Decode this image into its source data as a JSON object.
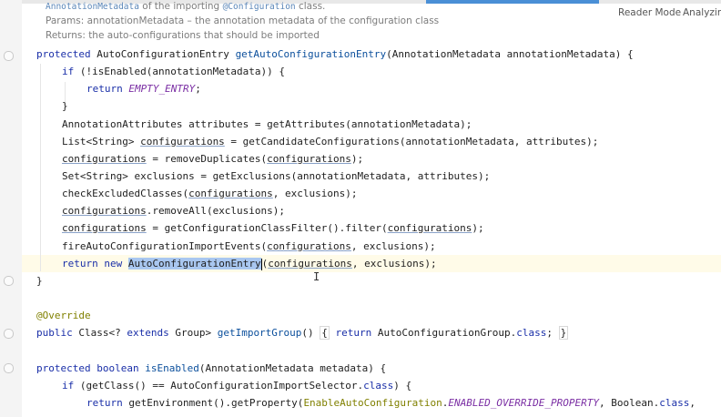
{
  "doc": {
    "line1_link": "AnnotationMetadata",
    "line1_mid": " of the importing ",
    "line1_link2": "@Configuration",
    "line1_end": " class.",
    "params": "Params: annotationMetadata – the annotation metadata of the configuration class",
    "returns": "Returns: the auto-configurations that should be imported"
  },
  "toolbar": {
    "reader_mode": "Reader Mode",
    "analyzing": "Analyzing..."
  },
  "code": {
    "l1": [
      "protected",
      " AutoConfigurationEntry ",
      "getAutoConfigurationEntry",
      "(AnnotationMetadata annotationMetadata) {"
    ],
    "l2": [
      "if",
      " (!isEnabled(annotationMetadata)) {"
    ],
    "l3": [
      "return",
      " ",
      "EMPTY_ENTRY",
      ";"
    ],
    "l4": "}",
    "l5": "AnnotationAttributes attributes = getAttributes(annotationMetadata);",
    "l6": [
      "List<String> ",
      "configurations",
      " = getCandidateConfigurations(annotationMetadata, attributes);"
    ],
    "l7": [
      "configurations",
      " = removeDuplicates(",
      "configurations",
      ");"
    ],
    "l8": "Set<String> exclusions = getExclusions(annotationMetadata, attributes);",
    "l9": [
      "checkExcludedClasses(",
      "configurations",
      ", exclusions);"
    ],
    "l10": [
      "configurations",
      ".removeAll(exclusions);"
    ],
    "l11": [
      "configurations",
      " = getConfigurationClassFilter().filter(",
      "configurations",
      ");"
    ],
    "l12": [
      "fireAutoConfigurationImportEvents(",
      "configurations",
      ", exclusions);"
    ],
    "l13": [
      "return",
      " ",
      "new",
      " ",
      "AutoConfigurationEntry",
      "(",
      "configurations",
      ", exclusions);"
    ],
    "l14": "}",
    "l15": "@Override",
    "l16": [
      "public",
      " Class<? ",
      "extends",
      " Group> ",
      "getImportGroup",
      "() ",
      "{",
      " ",
      "return",
      " AutoConfigurationGroup.",
      "class",
      "; ",
      "}"
    ],
    "l17": [
      "protected",
      " ",
      "boolean",
      " ",
      "isEnabled",
      "(AnnotationMetadata metadata) {"
    ],
    "l18": [
      "if",
      " (getClass() == AutoConfigurationImportSelector.",
      "class",
      ") {"
    ],
    "l19": [
      "return",
      " getEnvironment().getProperty(",
      "EnableAutoConfiguration",
      ".",
      "ENABLED_OVERRIDE_PROPERTY",
      ", Boolean.",
      "class",
      ","
    ]
  }
}
